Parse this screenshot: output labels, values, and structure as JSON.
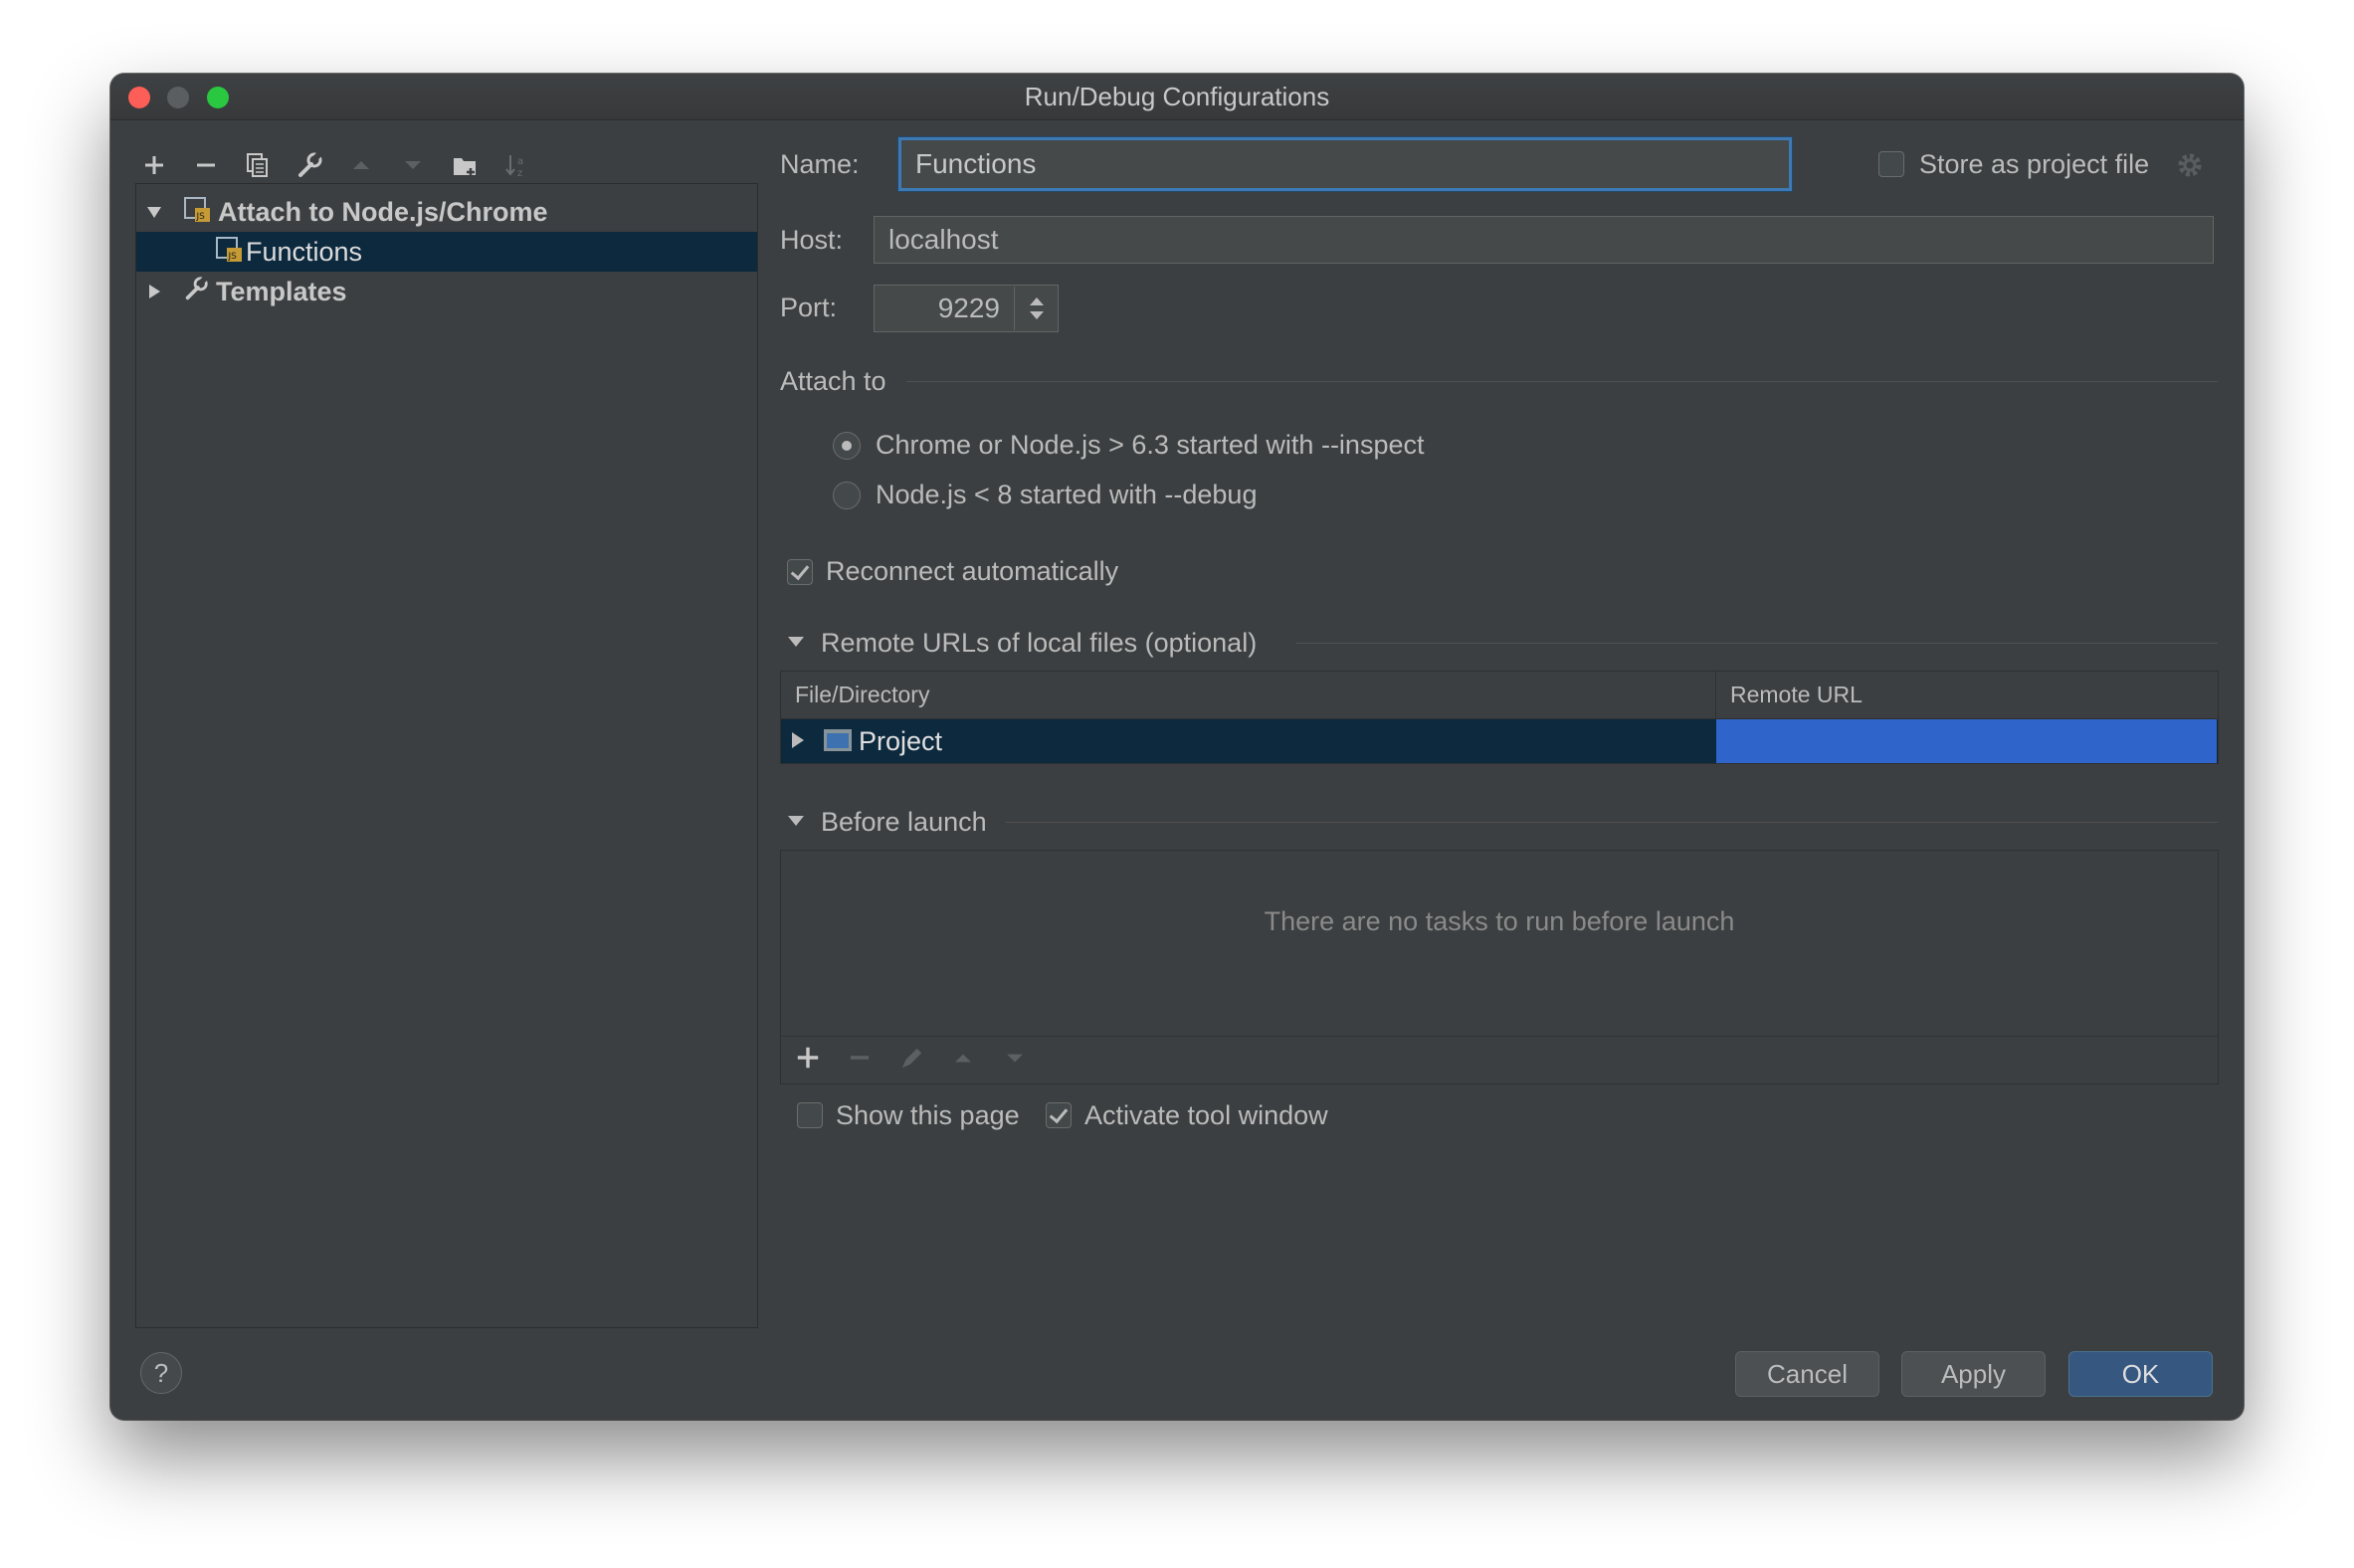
{
  "window": {
    "title": "Run/Debug Configurations"
  },
  "tree": {
    "group": "Attach to Node.js/Chrome",
    "child": "Functions",
    "templates": "Templates"
  },
  "form": {
    "name_label": "Name:",
    "name_value": "Functions",
    "store_label": "Store as project file",
    "host_label": "Host:",
    "host_value": "localhost",
    "port_label": "Port:",
    "port_value": "9229",
    "attach_to": "Attach to",
    "radio_inspect": "Chrome or Node.js > 6.3 started with --inspect",
    "radio_debug": "Node.js < 8 started with --debug",
    "reconnect": "Reconnect automatically"
  },
  "remote": {
    "section": "Remote URLs of local files (optional)",
    "col_file": "File/Directory",
    "col_url": "Remote URL",
    "row_project": "Project"
  },
  "before_launch": {
    "section": "Before launch",
    "empty": "There are no tasks to run before launch",
    "show_page": "Show this page",
    "activate": "Activate tool window"
  },
  "buttons": {
    "cancel": "Cancel",
    "apply": "Apply",
    "ok": "OK",
    "help": "?"
  },
  "colors": {
    "background": "#3c3f41",
    "selection": "#0d293e",
    "accent": "#2f65ca",
    "primary_button": "#365880"
  }
}
